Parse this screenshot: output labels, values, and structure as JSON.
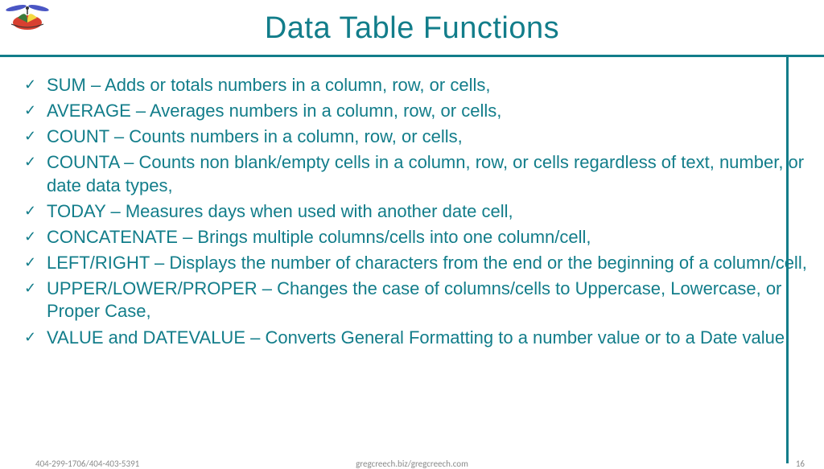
{
  "title": "Data Table Functions",
  "items": [
    "SUM – Adds or totals numbers in a column, row, or cells,",
    "AVERAGE – Averages numbers in a column, row, or cells,",
    "COUNT – Counts numbers in a column, row, or cells,",
    "COUNTA – Counts non blank/empty cells in a column, row, or cells regardless of text, number, or date data types,",
    "TODAY – Measures days when used with another date cell,",
    "CONCATENATE – Brings multiple columns/cells into one column/cell,",
    "LEFT/RIGHT – Displays the number of characters from the end or the beginning of a column/cell,",
    "UPPER/LOWER/PROPER – Changes the case of columns/cells to Uppercase, Lowercase, or Proper Case,",
    "VALUE and DATEVALUE – Converts General Formatting to a number value or to a Date value"
  ],
  "footer": {
    "left": "404-299-1706/404-403-5391",
    "center": "gregcreech.biz/gregcreech.com",
    "right": "16"
  }
}
